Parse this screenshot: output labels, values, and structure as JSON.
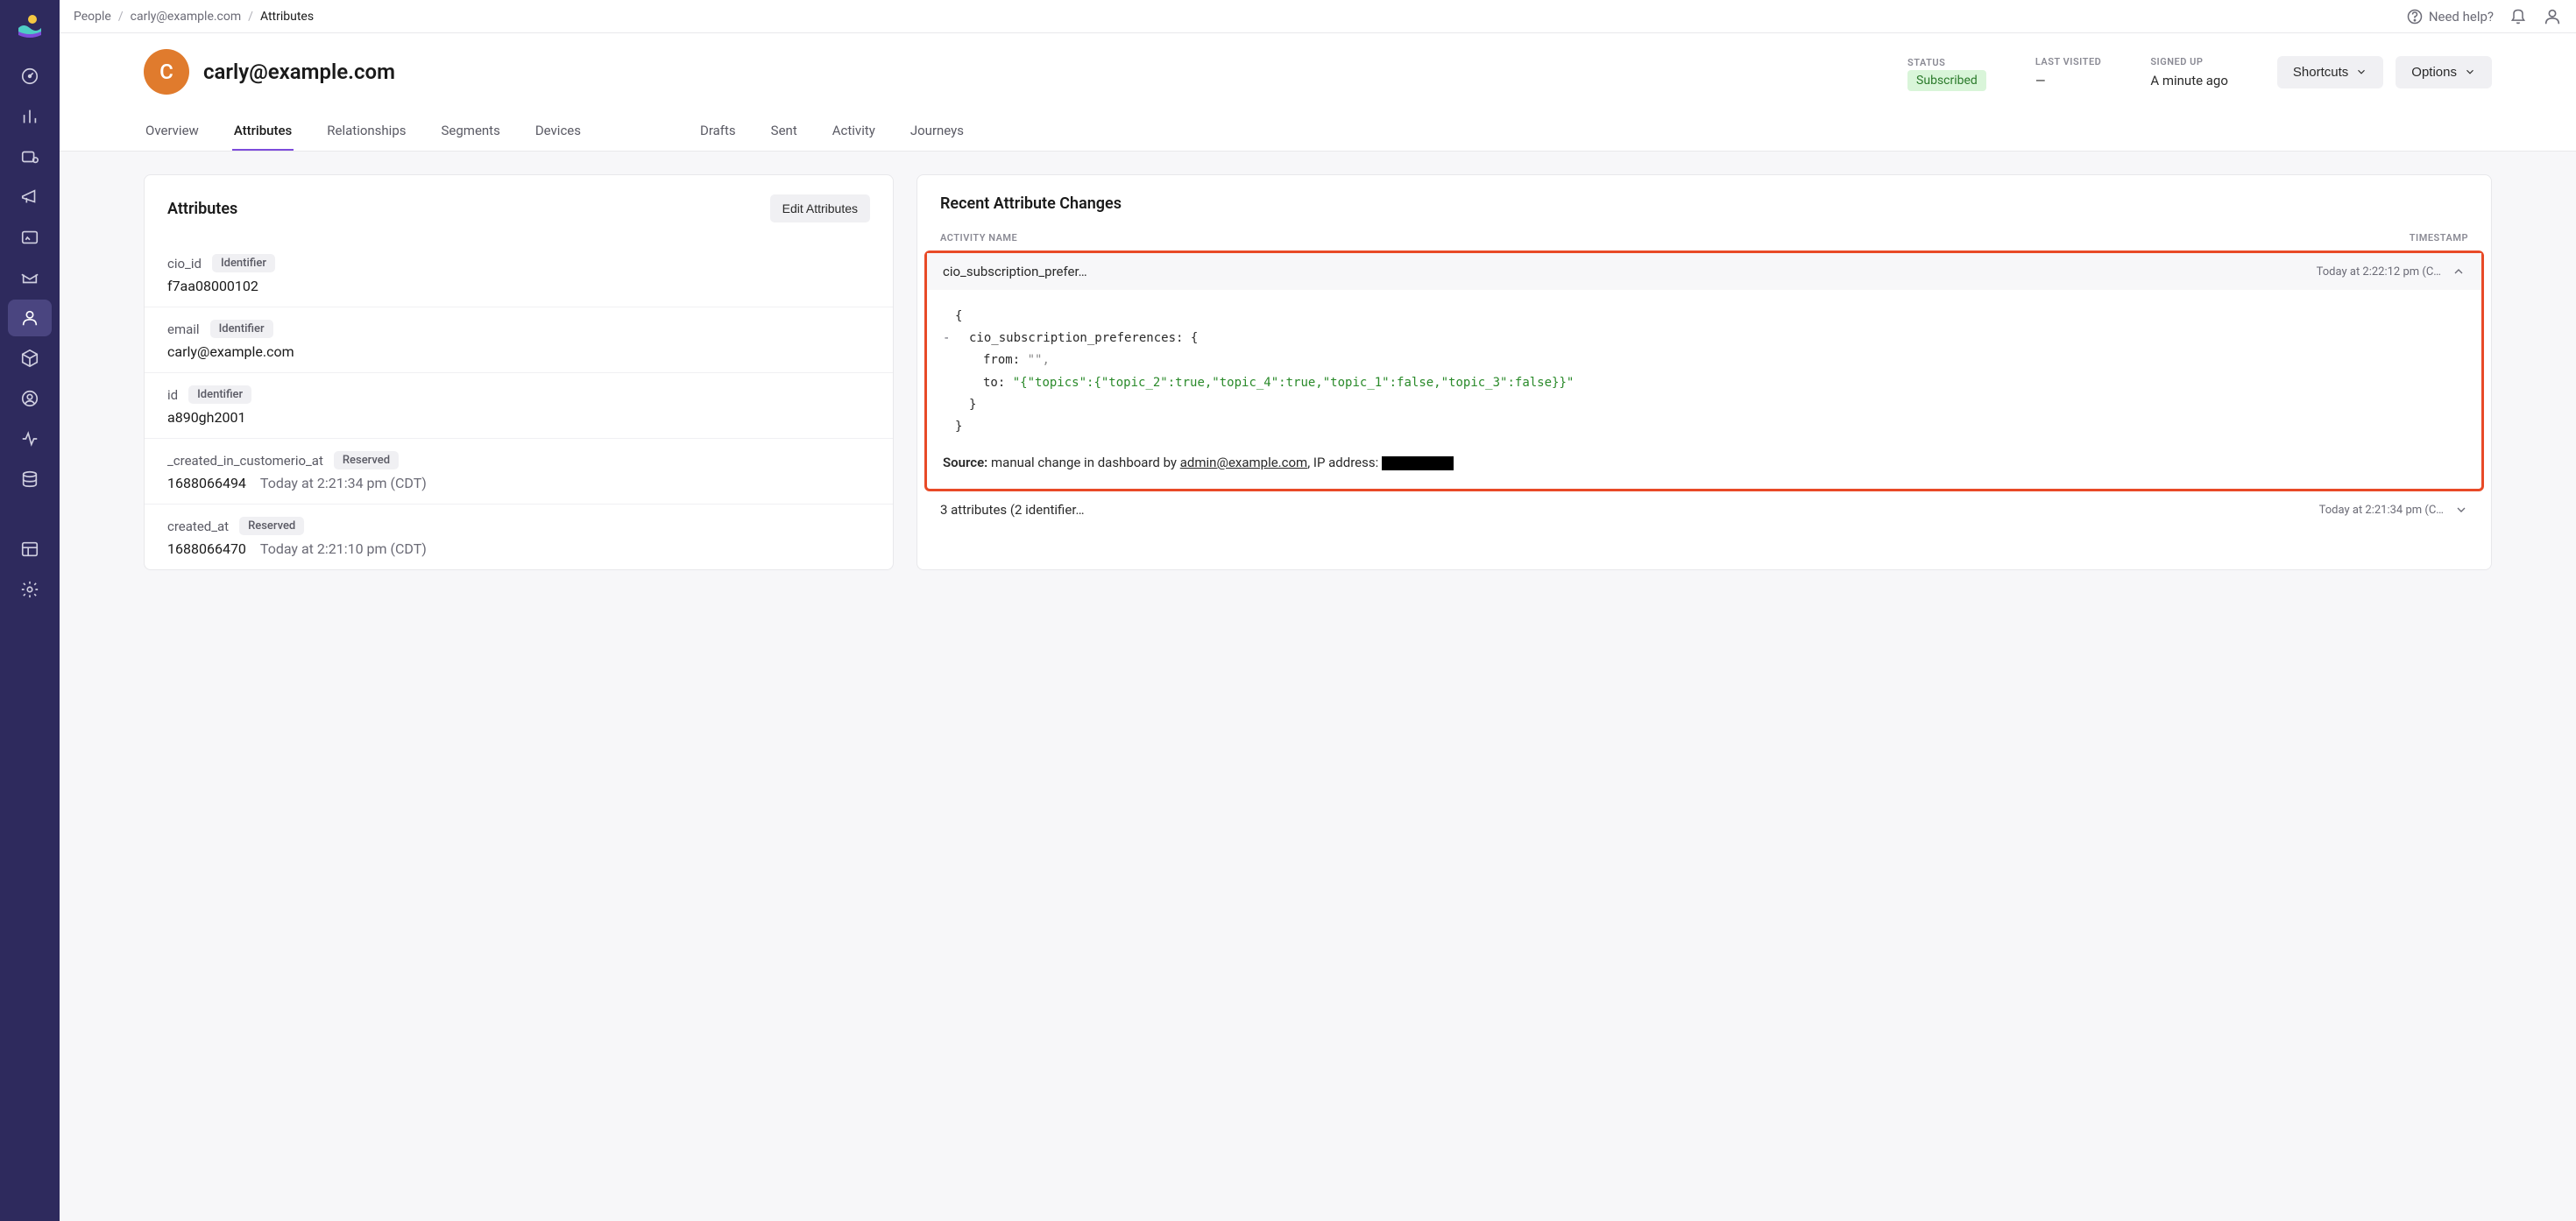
{
  "breadcrumb": {
    "root": "People",
    "email": "carly@example.com",
    "current": "Attributes"
  },
  "topbar": {
    "help": "Need help?"
  },
  "sidebar": {
    "icons": [
      "dashboard",
      "bars",
      "pipe",
      "megaphone",
      "terminal",
      "inbox",
      "person",
      "cube",
      "user-circle",
      "pulse",
      "database",
      "layout",
      "gear"
    ]
  },
  "profile": {
    "initial": "C",
    "name": "carly@example.com"
  },
  "meta": {
    "status_label": "STATUS",
    "status_value": "Subscribed",
    "last_visited_label": "LAST VISITED",
    "last_visited_value": "—",
    "signed_up_label": "SIGNED UP",
    "signed_up_value": "A minute ago"
  },
  "header_buttons": {
    "shortcuts": "Shortcuts",
    "options": "Options"
  },
  "tabs": {
    "overview": "Overview",
    "attributes": "Attributes",
    "relationships": "Relationships",
    "segments": "Segments",
    "devices": "Devices",
    "drafts": "Drafts",
    "sent": "Sent",
    "activity": "Activity",
    "journeys": "Journeys"
  },
  "attrs_panel": {
    "title": "Attributes",
    "edit": "Edit Attributes",
    "pill_identifier": "Identifier",
    "pill_reserved": "Reserved",
    "rows": [
      {
        "name": "cio_id",
        "pill": "Identifier",
        "value": "f7aa08000102"
      },
      {
        "name": "email",
        "pill": "Identifier",
        "value": "carly@example.com"
      },
      {
        "name": "id",
        "pill": "Identifier",
        "value": "a890gh2001"
      },
      {
        "name": "_created_in_customerio_at",
        "pill": "Reserved",
        "value": "1688066494",
        "sub": "Today at 2:21:34 pm (CDT)"
      },
      {
        "name": "created_at",
        "pill": "Reserved",
        "value": "1688066470",
        "sub": "Today at 2:21:10 pm (CDT)"
      }
    ]
  },
  "changes_panel": {
    "title": "Recent Attribute Changes",
    "col1": "ACTIVITY NAME",
    "col2": "TIMESTAMP",
    "item1": {
      "name": "cio_subscription_prefer…",
      "time": "Today at 2:22:12 pm (C…"
    },
    "json": {
      "open": "{",
      "key": "cio_subscription_preferences: {",
      "from_key": "from:",
      "from_val": "\"\",",
      "to_key": "to:",
      "to_val": "\"{\"topics\":{\"topic_2\":true,\"topic_4\":true,\"topic_1\":false,\"topic_3\":false}}\"",
      "close_inner": "}",
      "close": "}"
    },
    "source": {
      "label": "Source:",
      "text1": "manual change in dashboard by",
      "email": "admin@example.com",
      "text2": ", IP address:"
    },
    "item2": {
      "name": "3 attributes (2 identifier…",
      "time": "Today at 2:21:34 pm (C…"
    }
  }
}
